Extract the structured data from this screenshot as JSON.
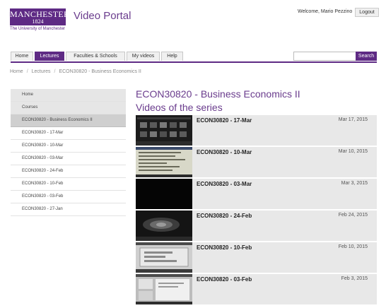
{
  "header": {
    "logo_word": "MANCHESTER",
    "logo_year": "1824",
    "university": "The University of Manchester",
    "portal_title": "Video Portal",
    "welcome": "Welcome, Mario Pezzino",
    "logout_label": "Logout"
  },
  "nav": {
    "tabs": [
      {
        "label": "Home"
      },
      {
        "label": "Lectures"
      },
      {
        "label": "Faculties & Schools"
      },
      {
        "label": "My videos"
      },
      {
        "label": "Help"
      }
    ],
    "active_tab": "Lectures",
    "search": {
      "value": "",
      "button_label": "Search"
    }
  },
  "breadcrumb": [
    "Home",
    "Lectures",
    "ECON30820 - Business Economics II"
  ],
  "sidebar": {
    "items": [
      {
        "label": "Home"
      },
      {
        "label": "Courses"
      },
      {
        "label": "ECON30820 - Business Economics II"
      },
      {
        "label": "ECON30820 - 17-Mar"
      },
      {
        "label": "ECON30820 - 10-Mar"
      },
      {
        "label": "ECON30820 - 03-Mar"
      },
      {
        "label": "ECON30820 - 24-Feb"
      },
      {
        "label": "ECON30820 - 10-Feb"
      },
      {
        "label": "ECON30820 - 03-Feb"
      },
      {
        "label": "ECON30820 - 27-Jan"
      }
    ]
  },
  "main": {
    "title": "ECON30820 - Business Economics II",
    "subtitle": "Videos of the series",
    "videos": [
      {
        "title": "ECON30820 - 17-Mar",
        "date": "Mar 17, 2015"
      },
      {
        "title": "ECON30820 - 10-Mar",
        "date": "Mar 10, 2015"
      },
      {
        "title": "ECON30820 - 03-Mar",
        "date": "Mar 3, 2015"
      },
      {
        "title": "ECON30820 - 24-Feb",
        "date": "Feb 24, 2015"
      },
      {
        "title": "ECON30820 - 10-Feb",
        "date": "Feb 10, 2015"
      },
      {
        "title": "ECON30820 - 03-Feb",
        "date": "Feb 3, 2015"
      }
    ]
  },
  "colors": {
    "brand": "#5e2a84",
    "title": "#6a3c8d"
  }
}
